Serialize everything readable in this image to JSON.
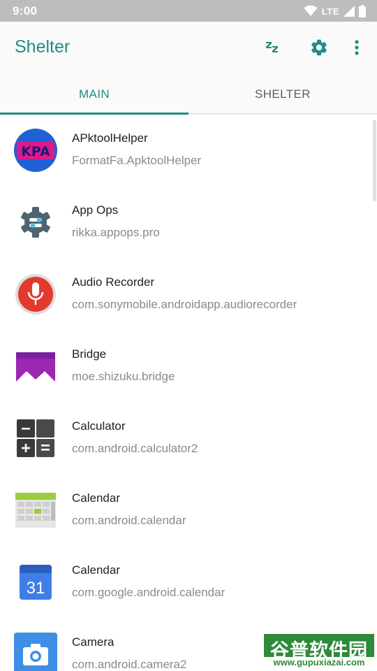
{
  "status_bar": {
    "time": "9:00",
    "network": "LTE"
  },
  "app_bar": {
    "title": "Shelter",
    "actions": {
      "sleep_icon": "sleep-zz-icon",
      "settings_icon": "gear-icon",
      "more_icon": "more-vert-icon"
    }
  },
  "tabs": [
    {
      "label": "MAIN",
      "selected": true
    },
    {
      "label": "SHELTER",
      "selected": false
    }
  ],
  "colors": {
    "accent": "#1f8f7f",
    "status_bar": "#bdbdbd"
  },
  "apps": [
    {
      "name": "APktoolHelper",
      "package": "FormatFa.ApktoolHelper",
      "icon": "apktoolhelper-icon",
      "icon_text": "KPA"
    },
    {
      "name": "App Ops",
      "package": "rikka.appops.pro",
      "icon": "app-ops-gear-icon"
    },
    {
      "name": "Audio Recorder",
      "package": "com.sonymobile.androidapp.audiorecorder",
      "icon": "microphone-icon"
    },
    {
      "name": "Bridge",
      "package": "moe.shizuku.bridge",
      "icon": "bridge-icon"
    },
    {
      "name": "Calculator",
      "package": "com.android.calculator2",
      "icon": "calculator-icon"
    },
    {
      "name": "Calendar",
      "package": "com.android.calendar",
      "icon": "calendar-grid-icon"
    },
    {
      "name": "Calendar",
      "package": "com.google.android.calendar",
      "icon": "google-calendar-icon",
      "icon_text": "31"
    },
    {
      "name": "Camera",
      "package": "com.android.camera2",
      "icon": "camera-icon"
    }
  ],
  "watermark": {
    "title": "谷普软件园",
    "url": "www.gupuxiazai.com"
  }
}
